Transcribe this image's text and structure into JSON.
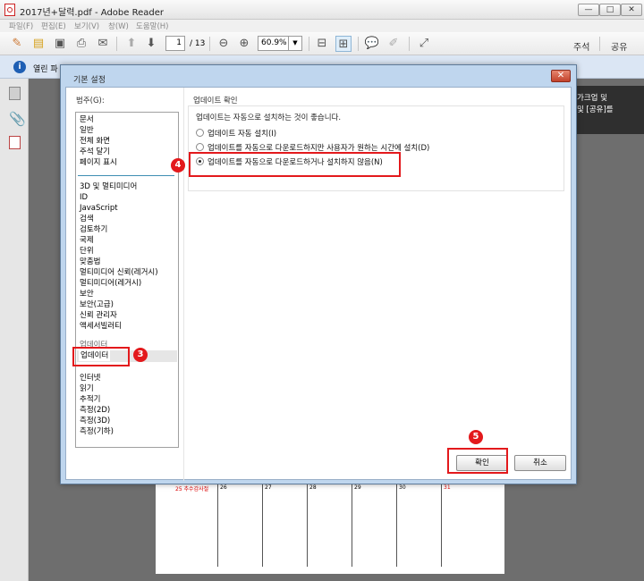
{
  "window": {
    "title": "2017년+달력.pdf - Adobe Reader",
    "min": "—",
    "max": "□",
    "close": "✕"
  },
  "menu": [
    "파일(F)",
    "편집(E)",
    "보기(V)",
    "창(W)",
    "도움말(H)"
  ],
  "toolbar": {
    "page_value": "1",
    "page_total": "/ 13",
    "zoom_value": "60.9%",
    "comment": "주석",
    "share": "공유"
  },
  "notification": {
    "text": "열린 파"
  },
  "right_panel": {
    "line1": "가크업 및",
    "line2": "및 [공유]를"
  },
  "calendar": {
    "header": "25   추수감사절",
    "days": [
      "26",
      "27",
      "28",
      "29",
      "30",
      "31"
    ]
  },
  "dialog": {
    "title": "기본 설정",
    "close": "✕",
    "category_label": "범주(G):",
    "categories_top": [
      "문서",
      "일반",
      "전체 화면",
      "주석 달기",
      "페이지 표시"
    ],
    "categories": [
      "3D 및 멀티미디어",
      "ID",
      "JavaScript",
      "검색",
      "검토하기",
      "국제",
      "단위",
      "맞춤법",
      "멀티미디어 신뢰(레거시)",
      "멀티미디어(레거시)",
      "보안",
      "보안(고급)",
      "신뢰 관리자",
      "액세서빌러티",
      "업데이터",
      "업데이터",
      "인터넷",
      "읽기",
      "추적기",
      "측정(2D)",
      "측정(3D)",
      "측정(기하)"
    ],
    "selected_index": 14,
    "group_title": "업데이트 확인",
    "group_desc": "업데이트는 자동으로 설치하는 것이 좋습니다.",
    "options": [
      "업데이트 자동 설치(I)",
      "업데이트를 자동으로 다운로드하지만 사용자가 원하는 시간에 설치(D)",
      "업데이트를 자동으로 다운로드하거나 설치하지 않음(N)"
    ],
    "selected_option": 2,
    "ok": "확인",
    "cancel": "취소"
  },
  "badges": {
    "step3": "3",
    "step4": "4",
    "step5": "5"
  },
  "colors": {
    "highlight": "#e3191c",
    "dialog_frame": "#bfd6ee"
  }
}
